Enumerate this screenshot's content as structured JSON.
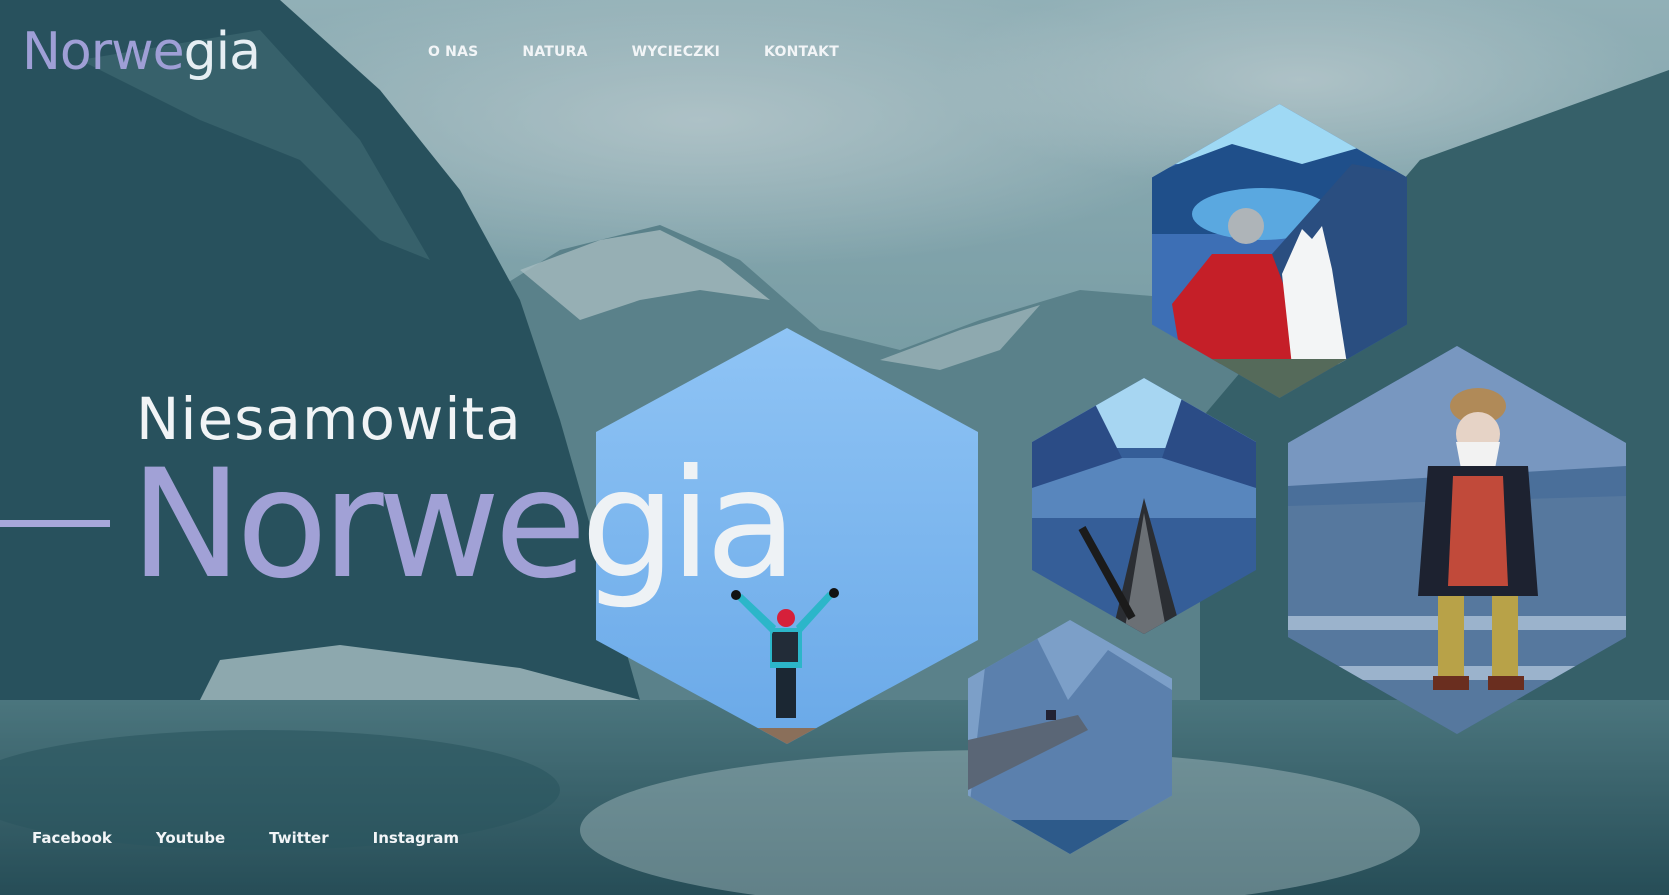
{
  "brand": {
    "part1": "Norwe",
    "part2": "gia"
  },
  "nav": {
    "items": [
      "O NAS",
      "NATURA",
      "WYCIECZKI",
      "KONTAKT"
    ]
  },
  "hero": {
    "subtitle": "Niesamowita",
    "title_part1": "Norwe",
    "title_part2": "gia"
  },
  "social": {
    "items": [
      "Facebook",
      "Youtube",
      "Twitter",
      "Instagram"
    ]
  },
  "colors": {
    "accent": "#a1a1d6",
    "text_light": "#eef2f5",
    "background": "#1f4650"
  },
  "gallery": {
    "images": [
      "hiker-photo",
      "man-with-dog-photo",
      "kayak-fjord-photo",
      "viking-in-boat-photo",
      "cliff-ledge-photo"
    ]
  }
}
